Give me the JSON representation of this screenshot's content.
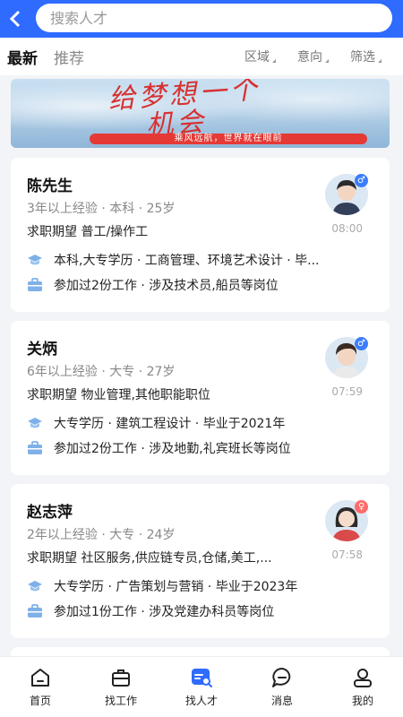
{
  "header": {
    "search_placeholder": "搜索人才",
    "back_icon": "back-arrow-icon"
  },
  "tabs": [
    {
      "label": "最新",
      "active": true
    },
    {
      "label": "推荐",
      "active": false
    }
  ],
  "filters": [
    {
      "label": "区域"
    },
    {
      "label": "意向"
    },
    {
      "label": "筛选"
    }
  ],
  "banner": {
    "title_line1": "给梦想一个",
    "title_line2": "机会",
    "slogan": "乘风远航，世界就在眼前"
  },
  "candidates": [
    {
      "name": "陈先生",
      "meta": "3年以上经验 · 本科 · 25岁",
      "expect": "求职期望 普工/操作工",
      "time": "08:00",
      "gender": "male",
      "education": "本科,大专学历 · 工商管理、环境艺术设计 · 毕...",
      "work": "参加过2份工作 · 涉及技术员,船员等岗位"
    },
    {
      "name": "关炳",
      "meta": "6年以上经验 · 大专 · 27岁",
      "expect": "求职期望 物业管理,其他职能职位",
      "time": "07:59",
      "gender": "male",
      "education": "大专学历 · 建筑工程设计 · 毕业于2021年",
      "work": "参加过2份工作 · 涉及地勤,礼宾班长等岗位"
    },
    {
      "name": "赵志萍",
      "meta": "2年以上经验 · 大专 · 24岁",
      "expect": "求职期望 社区服务,供应链专员,仓储,美工,...",
      "time": "07:58",
      "gender": "female",
      "education": "大专学历 · 广告策划与营销 · 毕业于2023年",
      "work": "参加过1份工作 · 涉及党建办科员等岗位"
    }
  ],
  "nav": [
    {
      "label": "首页",
      "icon": "home-icon"
    },
    {
      "label": "找工作",
      "icon": "briefcase-icon"
    },
    {
      "label": "找人才",
      "icon": "find-talent-icon",
      "active": true
    },
    {
      "label": "消息",
      "icon": "message-icon"
    },
    {
      "label": "我的",
      "icon": "profile-icon"
    }
  ],
  "colors": {
    "brand": "#2f6bff",
    "male": "#3b7dff",
    "female": "#ff6b6b"
  }
}
